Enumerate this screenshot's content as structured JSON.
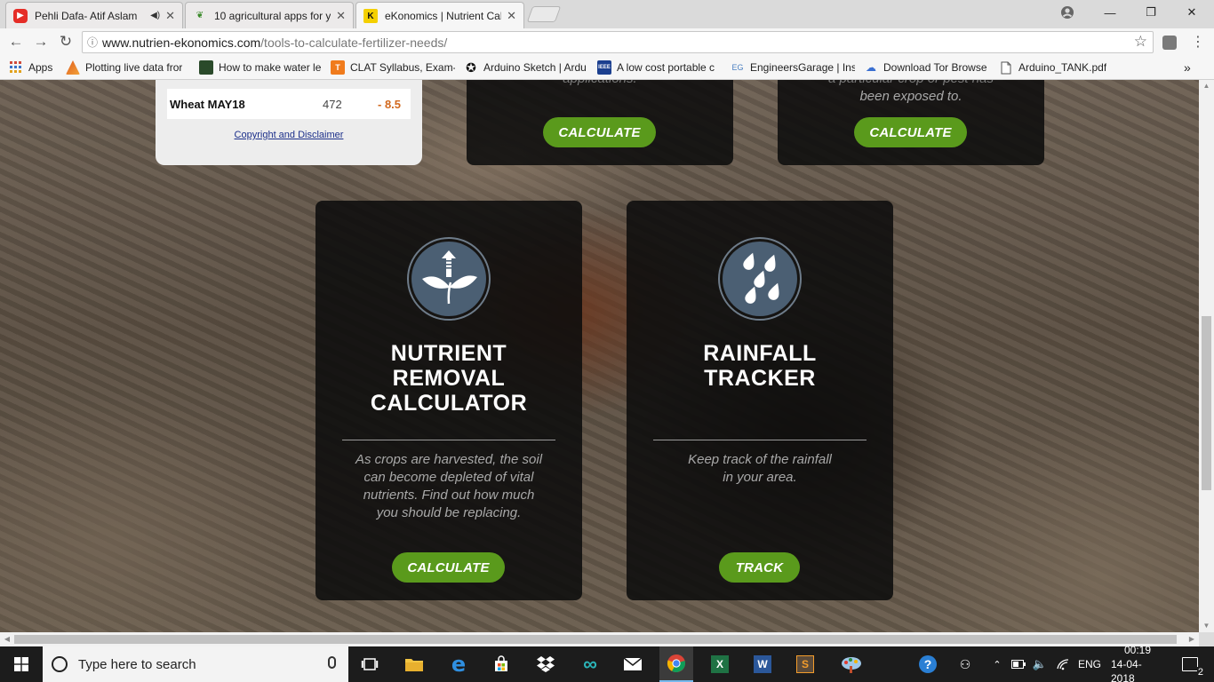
{
  "browser": {
    "tabs": [
      {
        "title": "Pehli Dafa- Atif Aslam",
        "favicon": "youtube-icon",
        "active": false,
        "audio": true
      },
      {
        "title": "10 agricultural apps for y",
        "favicon": "leaf-icon",
        "active": false,
        "audio": false
      },
      {
        "title": "eKonomics | Nutrient Cal",
        "favicon": "k-icon",
        "favicon_text": "K",
        "active": true,
        "audio": false
      }
    ],
    "url_host": "www.nutrien-ekonomics.com",
    "url_path": "/tools-to-calculate-fertilizer-needs/",
    "bookmarks": [
      {
        "label": "Apps",
        "icon": "apps-grid-icon"
      },
      {
        "label": "Plotting live data fror",
        "icon": "matlab-icon"
      },
      {
        "label": "How to make water le",
        "icon": "circuit-icon"
      },
      {
        "label": "CLAT Syllabus, Exam-",
        "icon": "t-icon",
        "icon_text": "T"
      },
      {
        "label": "Arduino Sketch | Ardu",
        "icon": "star-icon"
      },
      {
        "label": "A low cost portable c",
        "icon": "ieee-icon",
        "icon_text": "IEEE"
      },
      {
        "label": "EngineersGarage | Ins",
        "icon": "eg-icon",
        "icon_text": "EG"
      },
      {
        "label": "Download Tor Browse",
        "icon": "tor-icon"
      },
      {
        "label": "Arduino_TANK.pdf",
        "icon": "file-icon"
      }
    ],
    "bookmarks_overflow": "»"
  },
  "ticker": {
    "commodity": "Wheat MAY18",
    "price": "472",
    "change": "- 8.5",
    "disclaimer": "Copyright and Disclaimer"
  },
  "top_cards": [
    {
      "desc_partial": "applications.",
      "button": "CALCULATE"
    },
    {
      "desc_partial_1": "a particular crop or pest has",
      "desc_partial_2": "been exposed to.",
      "button": "CALCULATE"
    }
  ],
  "cards": [
    {
      "icon": "sprout-arrow-icon",
      "title_lines": [
        "NUTRIENT",
        "REMOVAL",
        "CALCULATOR"
      ],
      "desc_lines": [
        "As crops are harvested, the soil",
        "can become depleted of vital",
        "nutrients. Find out how much",
        "you should be replacing."
      ],
      "button": "CALCULATE"
    },
    {
      "icon": "raindrops-icon",
      "title_lines": [
        "RAINFALL",
        "TRACKER"
      ],
      "desc_lines": [
        "Keep track of the rainfall",
        "in your area."
      ],
      "button": "TRACK"
    }
  ],
  "taskbar": {
    "search_placeholder": "Type here to search",
    "language": "ENG",
    "time": "00:19",
    "date": "14-04-2018",
    "notifications": "2"
  },
  "colors": {
    "button_green": "#5a9a1c",
    "ticker_change": "#d2691e",
    "icon_circle": "#4b5f73"
  }
}
